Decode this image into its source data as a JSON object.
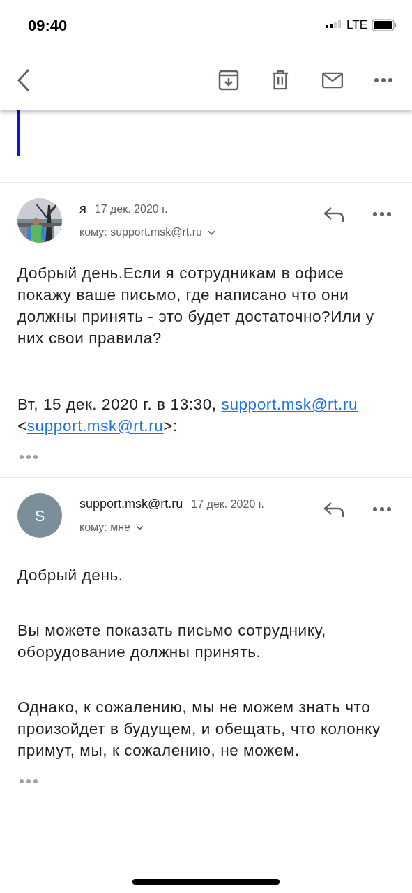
{
  "status_bar": {
    "time": "09:40",
    "network": "LTE"
  },
  "messages": [
    {
      "avatar": {
        "kind": "picture"
      },
      "sender": "я",
      "date": "17 дек. 2020 г.",
      "recipient": "кому: support.msk@rt.ru",
      "paragraphs": [
        "Добрый день.Если я сотрудникам в офисе покажу ваше письмо, где написано что они должны принять - это будет достаточно?Или у них свои правила?"
      ],
      "quote_header": [
        {
          "text": "Вт, 15 дек. 2020 г. в 13:30, ",
          "link": false
        },
        {
          "text": "support.msk@rt.ru",
          "link": true
        },
        {
          "text": " <",
          "link": false
        },
        {
          "text": "support.msk@rt.ru",
          "link": true
        },
        {
          "text": ">:",
          "link": false
        }
      ]
    },
    {
      "avatar": {
        "kind": "letter",
        "letter": "S"
      },
      "sender": "support.msk@rt.ru",
      "date": "17 дек. 2020 г.",
      "recipient": "кому: мне",
      "paragraphs": [
        "Добрый день.",
        "Вы можете показать письмо сотруднику, оборудование должны принять.",
        "Однако, к сожалению, мы не можем знать что произойдет в будущем, и обещать, что колонку примут, мы, к сожалению, не можем."
      ]
    }
  ]
}
